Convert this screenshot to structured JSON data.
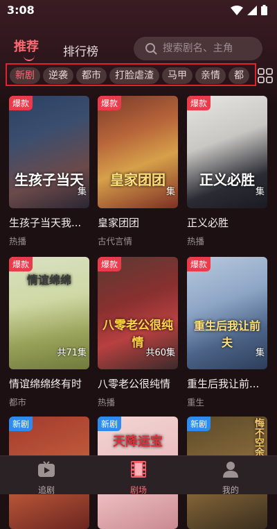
{
  "status_bar": {
    "time": "3:08"
  },
  "header": {
    "tabs": [
      {
        "label": "推荐",
        "active": true
      },
      {
        "label": "排行榜",
        "active": false
      }
    ],
    "search_placeholder": "搜索剧名、主角"
  },
  "categories": [
    "新剧",
    "逆袭",
    "都市",
    "打脸虐渣",
    "马甲",
    "亲情",
    "都"
  ],
  "cards": [
    {
      "badge": "爆款",
      "title": "生孩子当天我...",
      "tag": "热播",
      "eps": "集",
      "poster_text": "生孩子当天"
    },
    {
      "badge": "爆款",
      "title": "皇家团团",
      "tag": "古代言情",
      "eps": "集",
      "poster_text": "皇家团团"
    },
    {
      "badge": "爆款",
      "title": "正义必胜",
      "tag": "热播",
      "eps": "集",
      "poster_text": "正义必胜"
    },
    {
      "badge": "爆款",
      "title": "情谊绵绵终有时",
      "tag": "都市",
      "eps": "共71集",
      "poster_text": "情谊绵绵"
    },
    {
      "badge": "爆款",
      "title": "八零老公很纯情",
      "tag": "热播",
      "eps": "共60集",
      "poster_text": "八零老公很纯情"
    },
    {
      "badge": "爆款",
      "title": "重生后我让前...",
      "tag": "重生",
      "eps": "集",
      "poster_text": "重生后我让前夫"
    },
    {
      "badge": "新剧",
      "title": "",
      "tag": "",
      "eps": "",
      "poster_text": ""
    },
    {
      "badge": "新剧",
      "title": "",
      "tag": "",
      "eps": "",
      "poster_text": "天降运宝"
    },
    {
      "badge": "新剧",
      "title": "",
      "tag": "",
      "eps": "",
      "poster_text": "悔不空余"
    }
  ],
  "bottom_nav": [
    {
      "label": "追剧",
      "icon": "tv-icon",
      "active": false
    },
    {
      "label": "剧场",
      "icon": "film-icon",
      "active": true
    },
    {
      "label": "我的",
      "icon": "person-icon",
      "active": false
    }
  ],
  "colors": {
    "accent": "#ff6a72",
    "hot_badge": "#e93b49",
    "new_badge": "#2e8cf0",
    "background": "#1c1012"
  }
}
